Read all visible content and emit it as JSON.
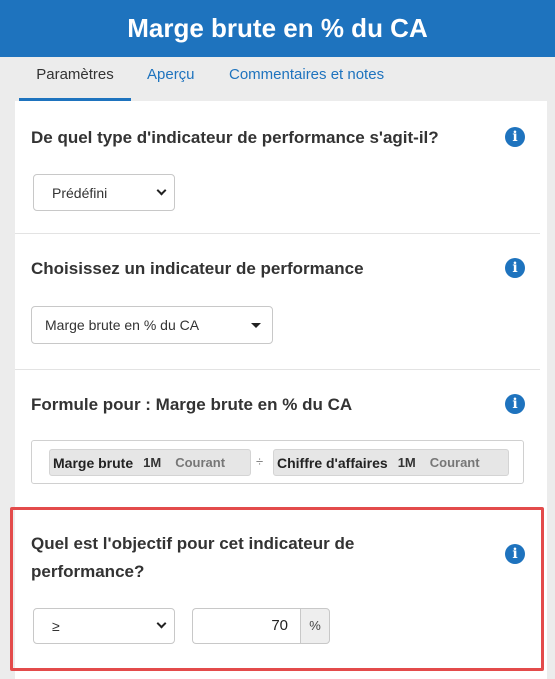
{
  "header": {
    "title": "Marge brute en % du CA"
  },
  "tabs": [
    {
      "label": "Paramètres",
      "active": true
    },
    {
      "label": "Aperçu",
      "active": false
    },
    {
      "label": "Commentaires et notes",
      "active": false
    }
  ],
  "sections": {
    "indicator_type": {
      "question": "De quel type d'indicateur de performance s'agit-il?",
      "selected": "Prédéfini"
    },
    "indicator_choice": {
      "question": "Choisissez un indicateur de performance",
      "selected": "Marge brute en % du CA"
    },
    "formula": {
      "title": "Formule pour : Marge brute en % du CA",
      "numerator": {
        "name": "Marge brute",
        "period": "1M",
        "scope": "Courant"
      },
      "operator": "÷",
      "denominator": {
        "name": "Chiffre d'affaires",
        "period": "1M",
        "scope": "Courant"
      }
    },
    "objective": {
      "question_line1": "Quel est l'objectif pour cet indicateur de",
      "question_line2": "performance?",
      "comparator": "≥",
      "value": "70",
      "unit": "%"
    }
  },
  "icons": {
    "info": "info-icon",
    "dropdown": "chevron-down-icon"
  },
  "colors": {
    "header_bg": "#1e73be",
    "accent": "#1e73be",
    "highlight_border": "#e34b4b"
  }
}
